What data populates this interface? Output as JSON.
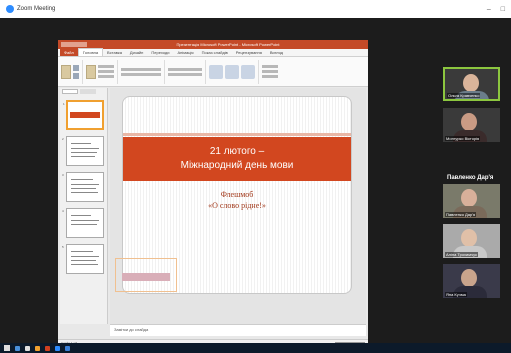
{
  "window": {
    "title": "Zoom Meeting",
    "minimize": "–",
    "maximize": "□"
  },
  "powerpoint": {
    "title": "Презентація Microsoft PowerPoint - Microsoft PowerPoint",
    "tabs": [
      "Файл",
      "Головна",
      "Вставка",
      "Дизайн",
      "Переходи",
      "Анімація",
      "Показ слайдів",
      "Рецензування",
      "Вигляд"
    ],
    "thumb_tabs": [
      "Слайди",
      "Структура"
    ],
    "slide": {
      "title_line1": "21 лютого –",
      "title_line2": "Міжнародний день мови",
      "subtitle_line1": "Флешмоб",
      "subtitle_line2": "«О слово рідне!»"
    },
    "notes_placeholder": "Замітки до слайда",
    "status": "Слайд 1 з 5"
  },
  "participants": [
    {
      "name": "Ольга Кравченко",
      "face": "#d9b49a",
      "body": "#6b7d8a",
      "bg": "#5a5a4a"
    },
    {
      "name": "Монгурко Вікторія",
      "face": "#c99b84",
      "body": "#3a2b2b",
      "bg": "#555"
    },
    {
      "name": "Павленко Дар'я",
      "face": "#d8b09a",
      "body": "#7a6a5a",
      "bg": "#7a7a6a"
    },
    {
      "name": "Аліна Трохимчук",
      "face": "#e0c0a8",
      "body": "#c9c9c9",
      "bg": "#aaa"
    },
    {
      "name": "Яна Кучма",
      "face": "#c9a48c",
      "body": "#2b2b3a",
      "bg": "#3a3a4a"
    }
  ],
  "active_speaker": "Павленко Дар'я"
}
